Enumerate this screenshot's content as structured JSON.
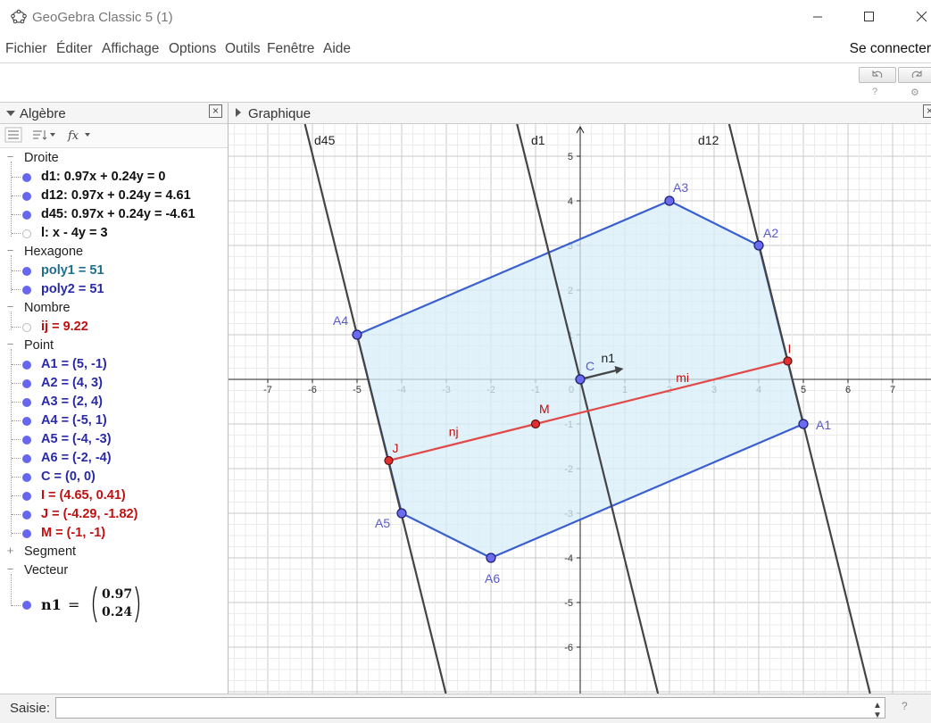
{
  "window": {
    "title": "GeoGebra Classic 5 (1)"
  },
  "menu": {
    "items": [
      "Fichier",
      "Éditer",
      "Affichage",
      "Options",
      "Outils",
      "Fenêtre",
      "Aide"
    ],
    "connect": "Se connecter"
  },
  "toolbar": {
    "undo_icon": "undo-icon",
    "redo_icon": "redo-icon",
    "help_icon": "?",
    "settings_icon": "⚙"
  },
  "algebra": {
    "title": "Algèbre",
    "groups": [
      {
        "label": "Droite",
        "items": [
          {
            "text": "d1: 0.97x + 0.24y = 0",
            "color": "#111111",
            "visible": true
          },
          {
            "text": "d12: 0.97x + 0.24y = 4.61",
            "color": "#111111",
            "visible": true
          },
          {
            "text": "d45: 0.97x + 0.24y = -4.61",
            "color": "#111111",
            "visible": true
          },
          {
            "text": "l: x - 4y = 3",
            "color": "#111111",
            "visible": false
          }
        ]
      },
      {
        "label": "Hexagone",
        "items": [
          {
            "text": "poly1 = 51",
            "color": "#1e6e8e",
            "visible": true
          },
          {
            "text": "poly2 = 51",
            "color": "#2a2aa8",
            "visible": true
          }
        ]
      },
      {
        "label": "Nombre",
        "items": [
          {
            "text": "ij = 9.22",
            "color": "#c01010",
            "visible": false
          }
        ]
      },
      {
        "label": "Point",
        "items": [
          {
            "text": "A1 = (5, -1)",
            "color": "#2a2aa8",
            "visible": true
          },
          {
            "text": "A2 = (4, 3)",
            "color": "#2a2aa8",
            "visible": true
          },
          {
            "text": "A3 = (2, 4)",
            "color": "#2a2aa8",
            "visible": true
          },
          {
            "text": "A4 = (-5, 1)",
            "color": "#2a2aa8",
            "visible": true
          },
          {
            "text": "A5 = (-4, -3)",
            "color": "#2a2aa8",
            "visible": true
          },
          {
            "text": "A6 = (-2, -4)",
            "color": "#2a2aa8",
            "visible": true
          },
          {
            "text": "C = (0, 0)",
            "color": "#2a2aa8",
            "visible": true
          },
          {
            "text": "I = (4.65, 0.41)",
            "color": "#c01010",
            "visible": true
          },
          {
            "text": "J = (-4.29, -1.82)",
            "color": "#c01010",
            "visible": true
          },
          {
            "text": "M = (-1, -1)",
            "color": "#c01010",
            "visible": true
          }
        ]
      },
      {
        "label": "Segment",
        "collapsed": true,
        "items": []
      },
      {
        "label": "Vecteur",
        "items": []
      }
    ],
    "vector": {
      "name": "n1",
      "equals": "=",
      "v1": "0.97",
      "v2": "0.24"
    }
  },
  "graphics": {
    "title": "Graphique",
    "x_ticks": [
      "-7",
      "-6",
      "-5",
      "-4",
      "-3",
      "-2",
      "-1",
      "0",
      "1",
      "2",
      "3",
      "4",
      "5",
      "6",
      "7"
    ],
    "y_ticks": [
      "5",
      "4",
      "3",
      "2",
      "1",
      "-1",
      "-2",
      "-3",
      "-4",
      "-5",
      "-6"
    ],
    "hexagon": {
      "vertices": [
        [
          5,
          -1
        ],
        [
          4,
          3
        ],
        [
          2,
          4
        ],
        [
          -5,
          1
        ],
        [
          -4,
          -3
        ],
        [
          -2,
          -4
        ]
      ],
      "labels": [
        "A1",
        "A2",
        "A3",
        "A4",
        "A5",
        "A6"
      ],
      "fill": "#d7eef8",
      "stroke": "#3a5fd0"
    },
    "lines": [
      {
        "name": "d1",
        "a": 0.97,
        "b": 0.24,
        "c": 0
      },
      {
        "name": "d12",
        "a": 0.97,
        "b": 0.24,
        "c": 4.61
      },
      {
        "name": "d45",
        "a": 0.97,
        "b": 0.24,
        "c": -4.61
      }
    ],
    "segments": [
      {
        "from": [
          -4.29,
          -1.82
        ],
        "to": [
          -1,
          -1
        ],
        "label": "nj"
      },
      {
        "from": [
          -1,
          -1
        ],
        "to": [
          4.65,
          0.41
        ],
        "label": "mi"
      }
    ],
    "points_red": [
      {
        "label": "I",
        "x": 4.65,
        "y": 0.41
      },
      {
        "label": "J",
        "x": -4.29,
        "y": -1.82
      },
      {
        "label": "M",
        "x": -1,
        "y": -1
      }
    ],
    "point_c": {
      "label": "C",
      "x": 0,
      "y": 0
    },
    "vector_n1": {
      "label": "n1",
      "dx": 0.97,
      "dy": 0.24
    }
  },
  "input": {
    "label": "Saisie:",
    "value": "",
    "help": "?"
  }
}
